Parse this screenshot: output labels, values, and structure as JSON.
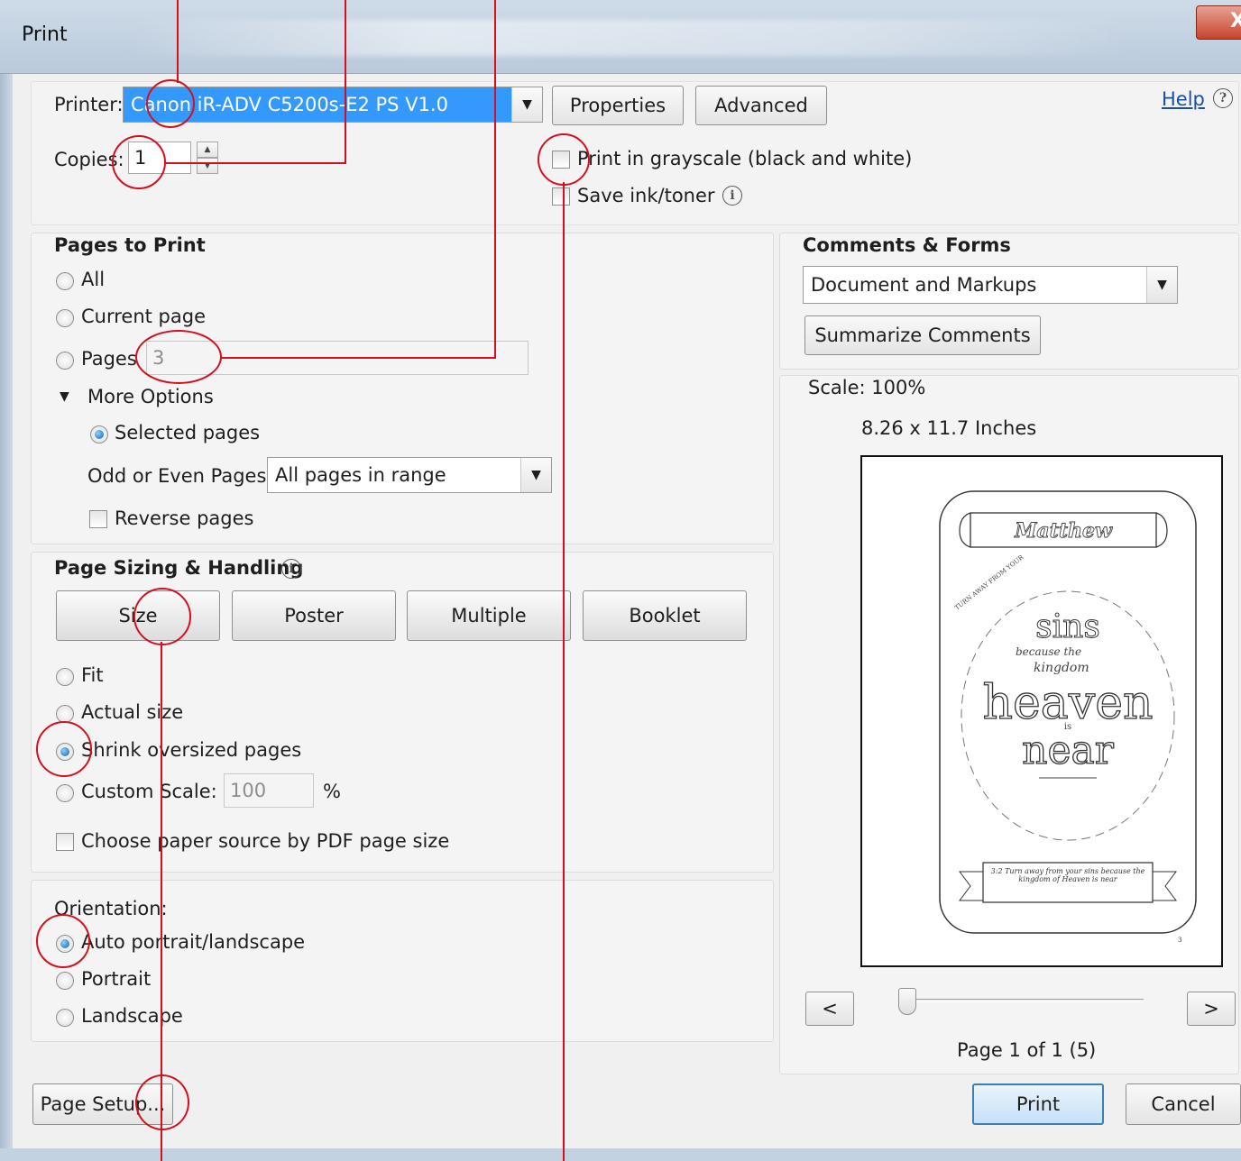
{
  "window": {
    "title": "Print",
    "close_label": "X"
  },
  "printer": {
    "label": "Printer:",
    "selected": "Canon iR-ADV C5200s-E2 PS V1.0",
    "properties_button": "Properties",
    "advanced_button": "Advanced",
    "help_link": "Help",
    "help_icon": "question-icon"
  },
  "copies": {
    "label": "Copies:",
    "value": "1"
  },
  "options": {
    "grayscale_label": "Print in grayscale (black and white)",
    "grayscale_checked": false,
    "save_ink_label": "Save ink/toner",
    "save_ink_checked": false
  },
  "pages_to_print": {
    "header": "Pages to Print",
    "all_label": "All",
    "current_label": "Current page",
    "pages_label": "Pages",
    "pages_value": "3",
    "more_options_label": "More Options",
    "selected_pages_label": "Selected pages",
    "odd_even_label": "Odd or Even Pages:",
    "odd_even_value": "All pages in range",
    "reverse_label": "Reverse pages",
    "selected": "Selected pages"
  },
  "sizing": {
    "header": "Page Sizing & Handling",
    "tabs": [
      "Size",
      "Poster",
      "Multiple",
      "Booklet"
    ],
    "fit_label": "Fit",
    "actual_label": "Actual size",
    "shrink_label": "Shrink oversized pages",
    "custom_label": "Custom Scale:",
    "custom_value": "100",
    "percent_label": "%",
    "paper_source_label": "Choose paper source by PDF page size",
    "selected": "Shrink oversized pages"
  },
  "orientation": {
    "header": "Orientation:",
    "auto_label": "Auto portrait/landscape",
    "portrait_label": "Portrait",
    "landscape_label": "Landscape",
    "selected": "Auto portrait/landscape"
  },
  "comments": {
    "header": "Comments & Forms",
    "value": "Document and Markups",
    "summarize_button": "Summarize Comments"
  },
  "preview": {
    "scale_label": "Scale: 100%",
    "size_label": "8.26 x 11.7 Inches",
    "page_label": "Page 1 of 1 (5)",
    "prev_label": "<",
    "next_label": ">",
    "slider_position": 0,
    "art": {
      "banner_title": "Matthew",
      "arc_text": "TURN AWAY FROM YOUR",
      "word1": "sins",
      "small1": "because the",
      "small2": "kingdom",
      "word2": "heaven",
      "small3": "is",
      "word3": "near",
      "verse": "3:2 Turn away from your sins because the kingdom of Heaven is near",
      "page_number": "3"
    }
  },
  "footer": {
    "page_setup_button": "Page Setup...",
    "print_button": "Print",
    "cancel_button": "Cancel"
  },
  "colors": {
    "annotation": "#d4101f",
    "selection": "#3399ff",
    "default_button_border": "#3c7fb1"
  }
}
